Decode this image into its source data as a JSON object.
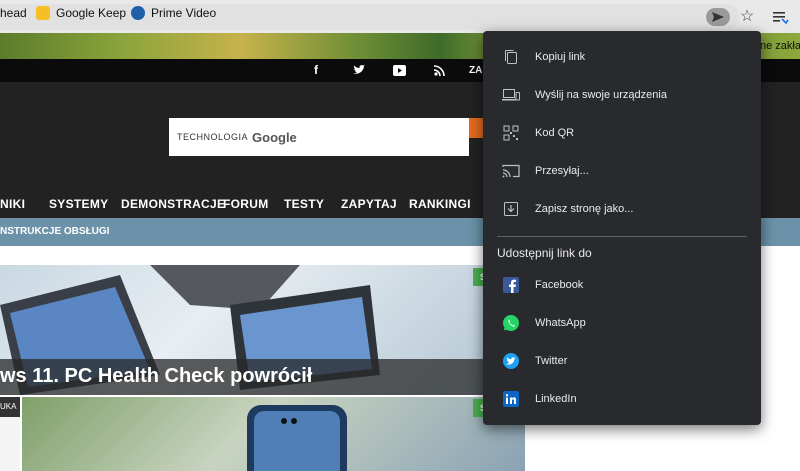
{
  "bookmarks": [
    {
      "label": "head"
    },
    {
      "label": "Google Keep"
    },
    {
      "label": "Prime Video"
    }
  ],
  "bookmarks_truncated": "ne zakła",
  "site": {
    "topbar_truncated": "ZAL",
    "search_label_small": "TECHNOLOGIA",
    "search_label_brand": "Google",
    "nav": [
      "NIKI",
      "SYSTEMY",
      "DEMONSTRACJE",
      "FORUM",
      "TESTY",
      "ZAPYTAJ",
      "RANKINGI"
    ],
    "subnav": "NSTRUKCJE OBSŁUGI",
    "article1_title": "ws 11. PC Health Check powrócił",
    "article1_badge": "S",
    "article2_tag": "UKA",
    "article2_badge": "S"
  },
  "share_menu": {
    "items": [
      {
        "label": "Kopiuj link",
        "icon": "copy-icon"
      },
      {
        "label": "Wyślij na swoje urządzenia",
        "icon": "devices-icon"
      },
      {
        "label": "Kod QR",
        "icon": "qr-code-icon"
      },
      {
        "label": "Przesyłaj...",
        "icon": "cast-icon"
      },
      {
        "label": "Zapisz stronę jako...",
        "icon": "save-page-icon"
      }
    ],
    "share_heading": "Udostępnij link do",
    "share_targets": [
      {
        "label": "Facebook",
        "icon": "facebook-icon",
        "color": "#3b5998"
      },
      {
        "label": "WhatsApp",
        "icon": "whatsapp-icon",
        "color": "#25d366"
      },
      {
        "label": "Twitter",
        "icon": "twitter-icon",
        "color": "#1da1f2"
      },
      {
        "label": "LinkedIn",
        "icon": "linkedin-icon",
        "color": "#0a66c2"
      }
    ]
  },
  "colors": {
    "menu_bg": "#292a2d",
    "nav_bg": "#222222",
    "subnav_bg": "#6b92a8",
    "search_btn": "#e36a1d"
  }
}
